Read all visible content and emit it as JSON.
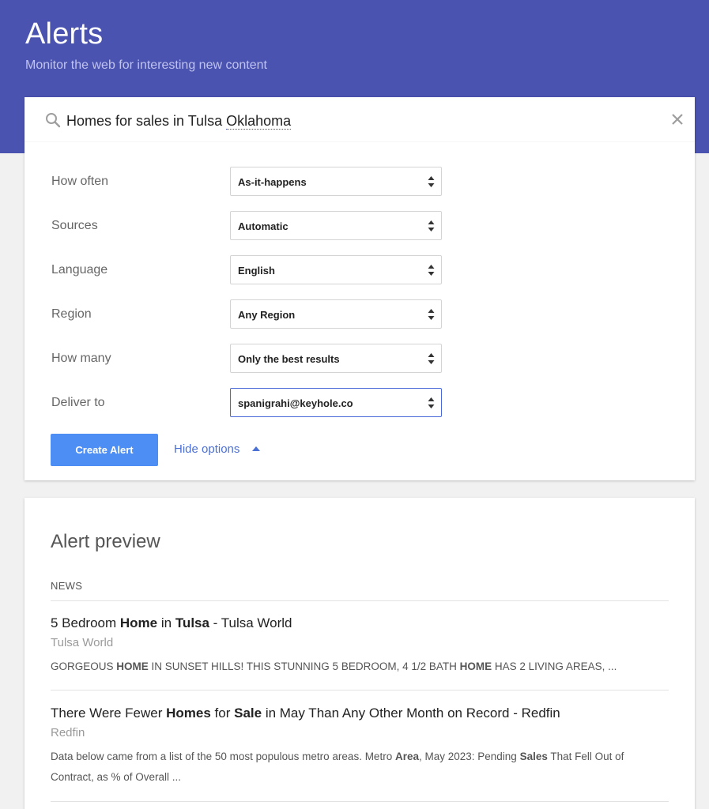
{
  "header": {
    "title": "Alerts",
    "subtitle": "Monitor the web for interesting new content"
  },
  "search": {
    "query_part1": "Homes for sales in Tulsa ",
    "query_part2": "Oklahoma"
  },
  "options": [
    {
      "label": "How often",
      "value": "As-it-happens"
    },
    {
      "label": "Sources",
      "value": "Automatic"
    },
    {
      "label": "Language",
      "value": "English"
    },
    {
      "label": "Region",
      "value": "Any Region"
    },
    {
      "label": "How many",
      "value": "Only the best results"
    },
    {
      "label": "Deliver to",
      "value": "spanigrahi@keyhole.co"
    }
  ],
  "actions": {
    "create_label": "Create Alert",
    "hide_label": "Hide options"
  },
  "preview": {
    "title": "Alert preview",
    "section": "NEWS",
    "results": [
      {
        "title": [
          {
            "t": "5 Bedroom ",
            "b": false
          },
          {
            "t": "Home",
            "b": true
          },
          {
            "t": " in ",
            "b": false
          },
          {
            "t": "Tulsa",
            "b": true
          },
          {
            "t": " - Tulsa World",
            "b": false
          }
        ],
        "source": "Tulsa World",
        "snippet": [
          {
            "t": "GORGEOUS ",
            "b": false
          },
          {
            "t": "HOME",
            "b": true
          },
          {
            "t": " IN SUNSET HILLS! THIS STUNNING 5 BEDROOM, 4 1/2 BATH ",
            "b": false
          },
          {
            "t": "HOME",
            "b": true
          },
          {
            "t": " HAS 2 LIVING AREAS, ...",
            "b": false
          }
        ]
      },
      {
        "title": [
          {
            "t": "There Were Fewer ",
            "b": false
          },
          {
            "t": "Homes",
            "b": true
          },
          {
            "t": " for ",
            "b": false
          },
          {
            "t": "Sale",
            "b": true
          },
          {
            "t": " in May Than Any Other Month on Record - Redfin",
            "b": false
          }
        ],
        "source": "Redfin",
        "snippet": [
          {
            "t": "Data below came from a list of the 50 most populous metro areas. Metro ",
            "b": false
          },
          {
            "t": "Area",
            "b": true
          },
          {
            "t": ", May 2023: Pending ",
            "b": false
          },
          {
            "t": "Sales",
            "b": true
          },
          {
            "t": " That Fell Out of Contract, as % of Overall ...",
            "b": false
          }
        ]
      }
    ]
  },
  "colors": {
    "header_bg": "#4b53b1",
    "button_bg": "#4d8ef4",
    "link": "#4b70d6"
  }
}
